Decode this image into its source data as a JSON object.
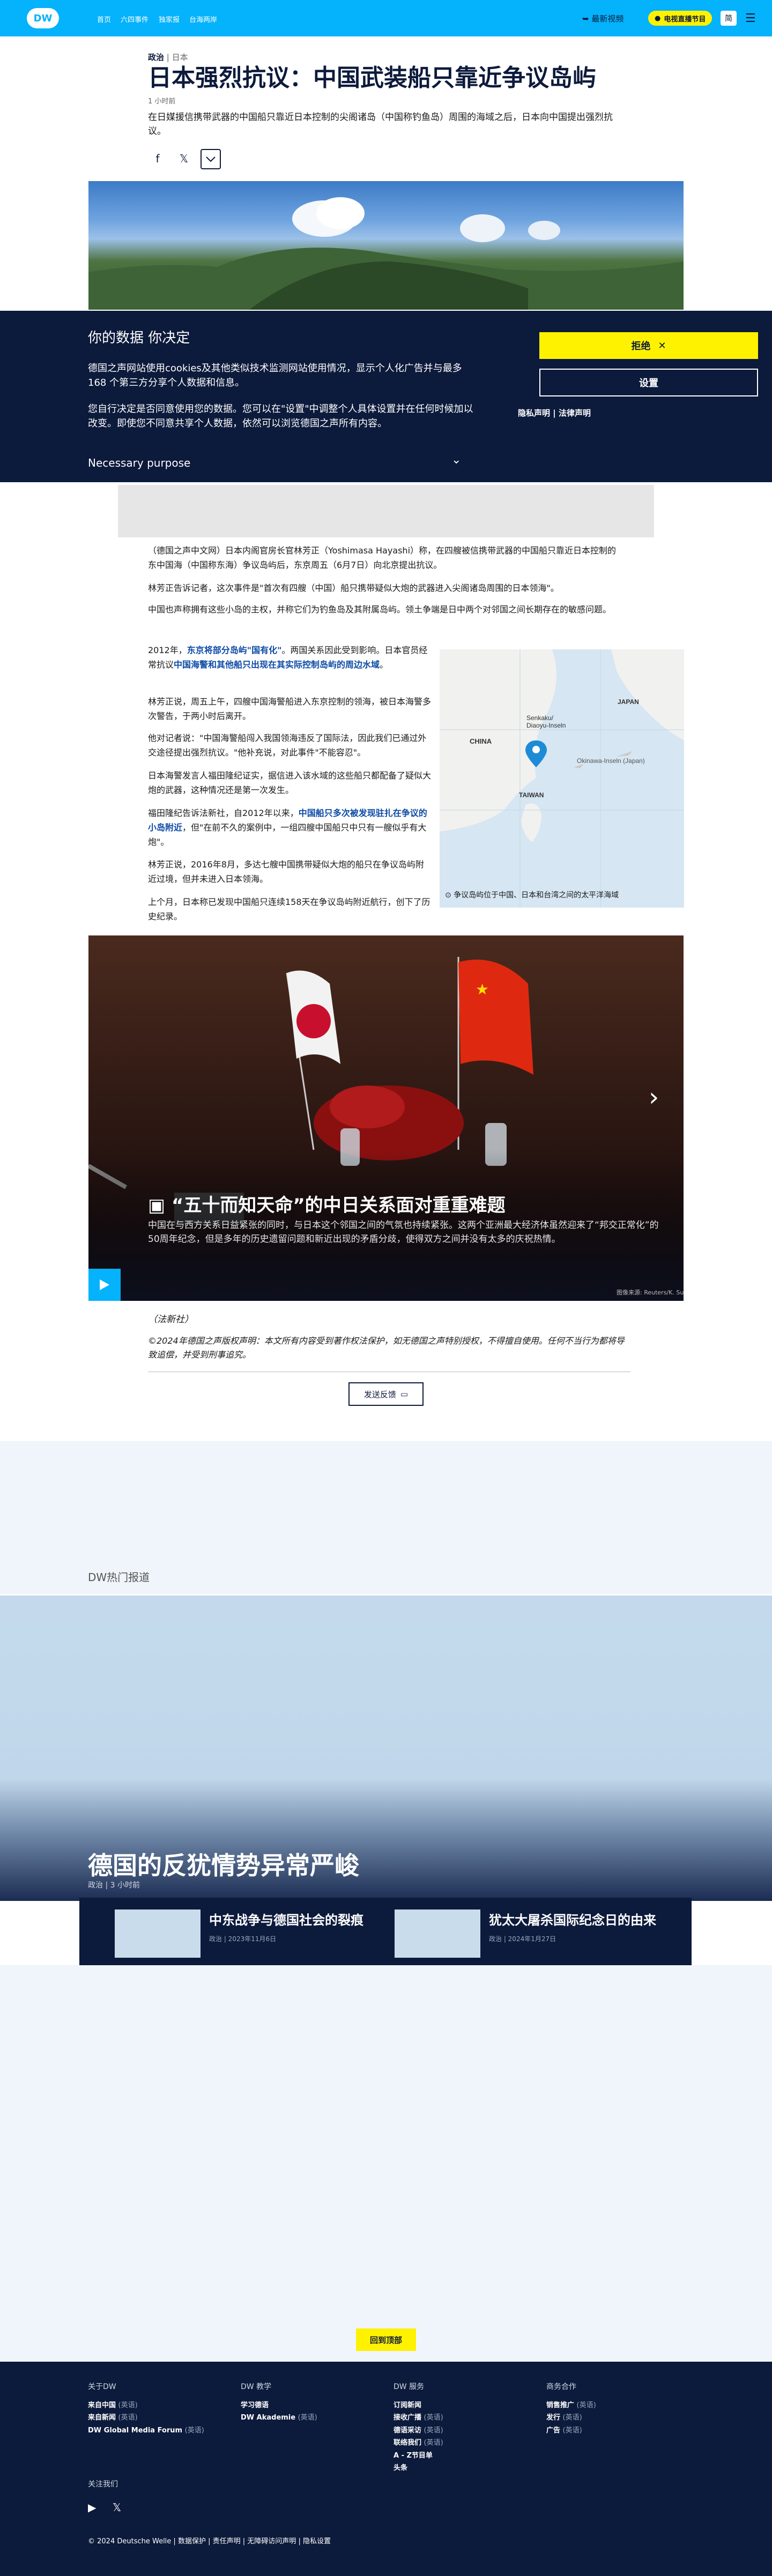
{
  "header": {
    "logo": "DW",
    "nav": [
      "首页",
      "六四事件",
      "独家报",
      "台海两岸"
    ],
    "live_label": "最新视频",
    "tv_label": "电视直播节目",
    "lang_label": "简",
    "menu_icon": "hamburger-icon"
  },
  "article": {
    "kicker_category": "政治",
    "kicker_sep": "|",
    "kicker_region": "日本",
    "title": "日本强烈抗议：中国武装船只靠近争议岛屿",
    "time": "1 小时前",
    "lead": "在日媒援信携带武器的中国船只靠近日本控制的尖阁诸岛（中国称钓鱼岛）周围的海域之后，日本向中国提出强烈抗议。",
    "share": [
      "facebook-icon",
      "x-icon",
      "chevron-down-icon"
    ],
    "paragraphs": [
      "（德国之声中文网）日本内阁官房长官林芳正（Yoshimasa Hayashi）称，在四艘被信携带武器的中国船只靠近日本控制的东中国海（中国称东海）争议岛屿后，东京周五（6月7日）向北京提出抗议。",
      "林芳正告诉记者，这次事件是\"首次有四艘（中国）船只携带疑似大炮的武器进入尖阁诸岛周围的日本领海\"。",
      "中国也声称拥有这些小岛的主权，并称它们为钓鱼岛及其附属岛屿。领土争端是日中两个对邻国之间长期存在的敏感问题。"
    ],
    "p4_pre": "2012年，",
    "p4_link1": "东京将部分岛屿\"国有化\"",
    "p4_mid": "。两国关系因此受到影响。日本官员经常抗议",
    "p4_link2": "中国海警和其他船只出现在其实际控制岛屿的周边水域",
    "p4_post": "。",
    "p5": "林芳正说，周五上午，四艘中国海警船进入东京控制的领海，被日本海警多次警告，于两小时后离开。",
    "p6": "他对记者说：\"中国海警船闯入我国领海违反了国际法，因此我们已通过外交途径提出强烈抗议。\"他补充说，对此事件\"不能容忍\"。",
    "p7": "日本海警发言人福田隆纪证实，据信进入该水域的这些船只都配备了疑似大炮的武器，这种情况还是第一次发生。",
    "p8_pre": "福田隆纪告诉法新社，自2012年以来，",
    "p8_link": "中国船只多次被发现驻扎在争议的小岛附近",
    "p8_post": "，但\"在前不久的案例中，一组四艘中国船只中只有一艘似乎有大炮\"。",
    "p9": "林芳正说，2016年8月，多达七艘中国携带疑似大炮的船只在争议岛屿附近过境，但并未进入日本领海。",
    "p10": "上个月，日本称已发现中国船只连续158天在争议岛屿附近航行，创下了历史纪录。",
    "map": {
      "labels": [
        "JAPAN",
        "CHINA",
        "Senkaku/",
        "Diaoyu-Inseln",
        "Okinawa-Inseln (Japan)",
        "TAIWAN"
      ],
      "caption": "争议岛屿位于中国、日本和台湾之间的太平洋海域"
    },
    "gallery": {
      "title": "“五十而知天命”的中日关系面对重重难题",
      "desc": "中国在与西方关系日益紧张的同时，与日本这个邻国之间的气氛也持续紧张。这两个亚洲最大经济体虽然迎来了“邦交正常化”的50周年纪念，但是多年的历史遗留问题和新近出现的矛盾分歧，使得双方之间并没有太多的庆祝热情。",
      "credit": "图像来源: Reuters/K. Su"
    },
    "source": "（法新社）",
    "copyright": "©2024年德国之声版权声明：本文所有内容受到著作权法保护，如无德国之声特别授权，不得擅自使用。任何不当行为都将导致追偿，并受到刑事追究。",
    "feedback": "发送反馈"
  },
  "cookie": {
    "title": "你的数据 你决定",
    "p1": "德国之声网站使用cookies及其他类似技术监测网站使用情况，显示个人化广告并与最多168 个第三方分享个人数据和信息。",
    "p2": "您自行决定是否同意使用您的数据。您可以在\"设置\"中调整个人具体设置并在任何时候加以改变。即使您不同意共享个人数据，依然可以浏览德国之声所有内容。",
    "reject": "拒绝",
    "settings": "设置",
    "privacy": "隐私声明",
    "link_sep": "|",
    "legal": "法律声明",
    "purpose": "Necessary purpose"
  },
  "bottom": {
    "hot_label": "DW热门报道",
    "feature_title": "德国的反犹情势异常严峻",
    "feature_meta": "政治 | 3 小时前",
    "cards": [
      {
        "title": "中东战争与德国社会的裂痕",
        "meta": "政治 | 2023年11月6日"
      },
      {
        "title": "犹太大屠杀国际纪念日的由来",
        "meta": "政治 | 2024年1月27日"
      }
    ],
    "to_top": "回到顶部"
  },
  "footer": {
    "columns": [
      {
        "head": "关于DW",
        "items": [
          [
            "来自中国",
            "(英语)"
          ],
          [
            "来自新闻",
            "(英语)"
          ],
          [
            "DW Global Media Forum",
            "(英语)"
          ]
        ]
      },
      {
        "head": "DW 教学",
        "items": [
          [
            "学习德语",
            ""
          ],
          [
            "DW Akademie",
            "(英语)"
          ]
        ]
      },
      {
        "head": "DW 服务",
        "items": [
          [
            "订阅新闻",
            ""
          ],
          [
            "接收广播",
            "(英语)"
          ],
          [
            "德语采访",
            "(英语)"
          ],
          [
            "联络我们",
            "(英语)"
          ],
          [
            "A - Z节目单",
            ""
          ],
          [
            "头条",
            ""
          ]
        ]
      },
      {
        "head": "商务合作",
        "items": [
          [
            "销售推广",
            "(英语)"
          ],
          [
            "发行",
            "(英语)"
          ],
          [
            "广告",
            "(英语)"
          ]
        ]
      }
    ],
    "follow": "关注我们",
    "social": [
      "youtube-icon",
      "x-icon"
    ],
    "legal": [
      "© 2024 Deutsche Welle",
      "数据保护",
      "责任声明",
      "无障碍访问声明",
      "隐私设置"
    ]
  },
  "colors": {
    "accent": "#05b2fc",
    "navy": "#0c1a3b",
    "yellow": "#fff200"
  }
}
